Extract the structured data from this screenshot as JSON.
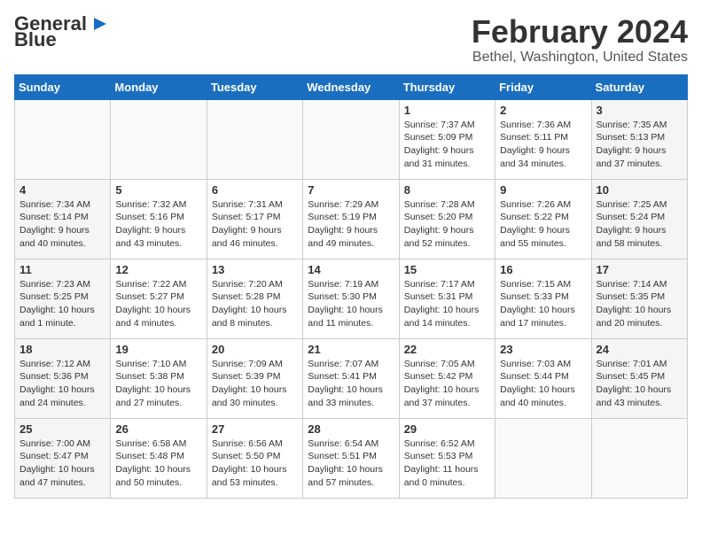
{
  "header": {
    "logo_general": "General",
    "logo_blue": "Blue",
    "main_title": "February 2024",
    "subtitle": "Bethel, Washington, United States"
  },
  "weekdays": [
    "Sunday",
    "Monday",
    "Tuesday",
    "Wednesday",
    "Thursday",
    "Friday",
    "Saturday"
  ],
  "weeks": [
    [
      {
        "day": "",
        "info": ""
      },
      {
        "day": "",
        "info": ""
      },
      {
        "day": "",
        "info": ""
      },
      {
        "day": "",
        "info": ""
      },
      {
        "day": "1",
        "info": "Sunrise: 7:37 AM\nSunset: 5:09 PM\nDaylight: 9 hours and 31 minutes."
      },
      {
        "day": "2",
        "info": "Sunrise: 7:36 AM\nSunset: 5:11 PM\nDaylight: 9 hours and 34 minutes."
      },
      {
        "day": "3",
        "info": "Sunrise: 7:35 AM\nSunset: 5:13 PM\nDaylight: 9 hours and 37 minutes."
      }
    ],
    [
      {
        "day": "4",
        "info": "Sunrise: 7:34 AM\nSunset: 5:14 PM\nDaylight: 9 hours and 40 minutes."
      },
      {
        "day": "5",
        "info": "Sunrise: 7:32 AM\nSunset: 5:16 PM\nDaylight: 9 hours and 43 minutes."
      },
      {
        "day": "6",
        "info": "Sunrise: 7:31 AM\nSunset: 5:17 PM\nDaylight: 9 hours and 46 minutes."
      },
      {
        "day": "7",
        "info": "Sunrise: 7:29 AM\nSunset: 5:19 PM\nDaylight: 9 hours and 49 minutes."
      },
      {
        "day": "8",
        "info": "Sunrise: 7:28 AM\nSunset: 5:20 PM\nDaylight: 9 hours and 52 minutes."
      },
      {
        "day": "9",
        "info": "Sunrise: 7:26 AM\nSunset: 5:22 PM\nDaylight: 9 hours and 55 minutes."
      },
      {
        "day": "10",
        "info": "Sunrise: 7:25 AM\nSunset: 5:24 PM\nDaylight: 9 hours and 58 minutes."
      }
    ],
    [
      {
        "day": "11",
        "info": "Sunrise: 7:23 AM\nSunset: 5:25 PM\nDaylight: 10 hours and 1 minute."
      },
      {
        "day": "12",
        "info": "Sunrise: 7:22 AM\nSunset: 5:27 PM\nDaylight: 10 hours and 4 minutes."
      },
      {
        "day": "13",
        "info": "Sunrise: 7:20 AM\nSunset: 5:28 PM\nDaylight: 10 hours and 8 minutes."
      },
      {
        "day": "14",
        "info": "Sunrise: 7:19 AM\nSunset: 5:30 PM\nDaylight: 10 hours and 11 minutes."
      },
      {
        "day": "15",
        "info": "Sunrise: 7:17 AM\nSunset: 5:31 PM\nDaylight: 10 hours and 14 minutes."
      },
      {
        "day": "16",
        "info": "Sunrise: 7:15 AM\nSunset: 5:33 PM\nDaylight: 10 hours and 17 minutes."
      },
      {
        "day": "17",
        "info": "Sunrise: 7:14 AM\nSunset: 5:35 PM\nDaylight: 10 hours and 20 minutes."
      }
    ],
    [
      {
        "day": "18",
        "info": "Sunrise: 7:12 AM\nSunset: 5:36 PM\nDaylight: 10 hours and 24 minutes."
      },
      {
        "day": "19",
        "info": "Sunrise: 7:10 AM\nSunset: 5:38 PM\nDaylight: 10 hours and 27 minutes."
      },
      {
        "day": "20",
        "info": "Sunrise: 7:09 AM\nSunset: 5:39 PM\nDaylight: 10 hours and 30 minutes."
      },
      {
        "day": "21",
        "info": "Sunrise: 7:07 AM\nSunset: 5:41 PM\nDaylight: 10 hours and 33 minutes."
      },
      {
        "day": "22",
        "info": "Sunrise: 7:05 AM\nSunset: 5:42 PM\nDaylight: 10 hours and 37 minutes."
      },
      {
        "day": "23",
        "info": "Sunrise: 7:03 AM\nSunset: 5:44 PM\nDaylight: 10 hours and 40 minutes."
      },
      {
        "day": "24",
        "info": "Sunrise: 7:01 AM\nSunset: 5:45 PM\nDaylight: 10 hours and 43 minutes."
      }
    ],
    [
      {
        "day": "25",
        "info": "Sunrise: 7:00 AM\nSunset: 5:47 PM\nDaylight: 10 hours and 47 minutes."
      },
      {
        "day": "26",
        "info": "Sunrise: 6:58 AM\nSunset: 5:48 PM\nDaylight: 10 hours and 50 minutes."
      },
      {
        "day": "27",
        "info": "Sunrise: 6:56 AM\nSunset: 5:50 PM\nDaylight: 10 hours and 53 minutes."
      },
      {
        "day": "28",
        "info": "Sunrise: 6:54 AM\nSunset: 5:51 PM\nDaylight: 10 hours and 57 minutes."
      },
      {
        "day": "29",
        "info": "Sunrise: 6:52 AM\nSunset: 5:53 PM\nDaylight: 11 hours and 0 minutes."
      },
      {
        "day": "",
        "info": ""
      },
      {
        "day": "",
        "info": ""
      }
    ]
  ]
}
